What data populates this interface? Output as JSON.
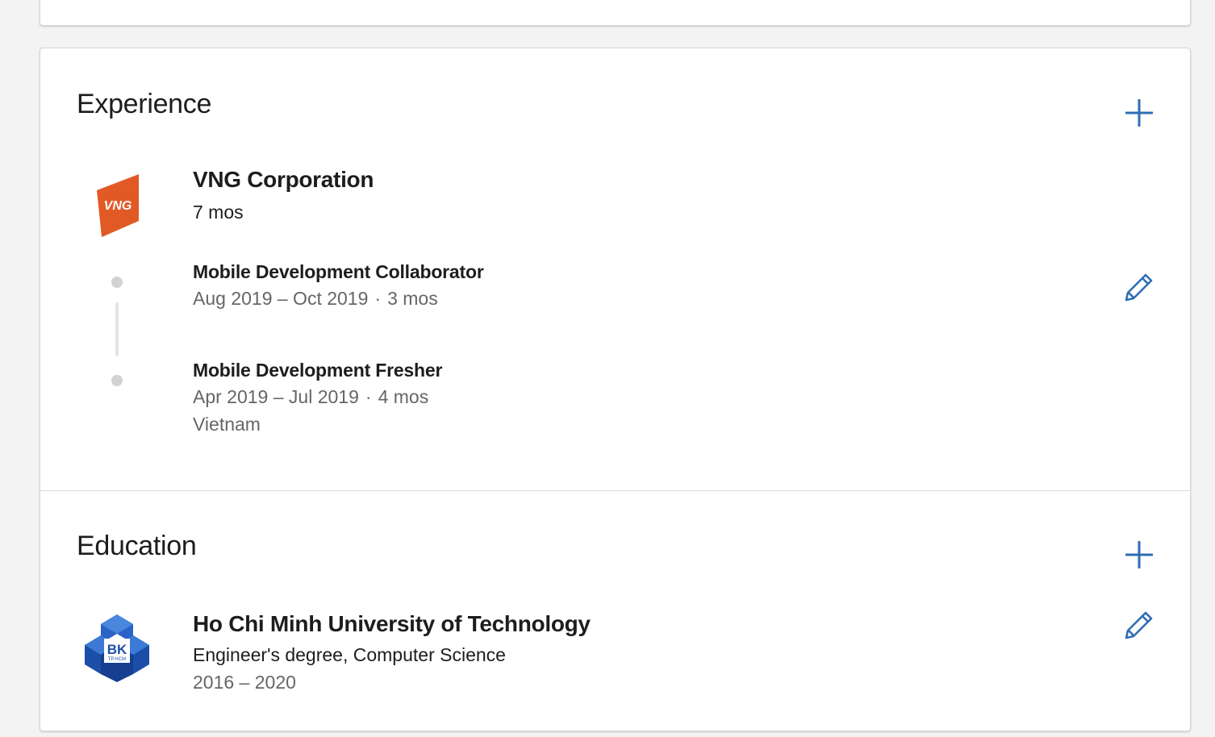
{
  "experience": {
    "title": "Experience",
    "company": {
      "name": "VNG Corporation",
      "duration": "7 mos",
      "logo_text": "VNG",
      "logo_color": "#e15a26"
    },
    "roles": [
      {
        "title": "Mobile Development Collaborator",
        "dates": "Aug 2019 – Oct 2019",
        "separator": "·",
        "length": "3 mos"
      },
      {
        "title": "Mobile Development Fresher",
        "dates": "Apr 2019 – Jul 2019",
        "separator": "·",
        "length": "4 mos",
        "location": "Vietnam"
      }
    ]
  },
  "education": {
    "title": "Education",
    "school": {
      "name": "Ho Chi Minh University of Technology",
      "degree": "Engineer's degree, Computer Science",
      "years": "2016 – 2020",
      "logo_text": "BK",
      "logo_subtext": "TP.HCM",
      "logo_color": "#1f4fa8"
    }
  },
  "colors": {
    "accent": "#2e6eb3",
    "page_bg": "#f3f3f3",
    "muted_text": "#666666"
  },
  "icons": {
    "add": "plus-icon",
    "edit": "pencil-icon"
  }
}
